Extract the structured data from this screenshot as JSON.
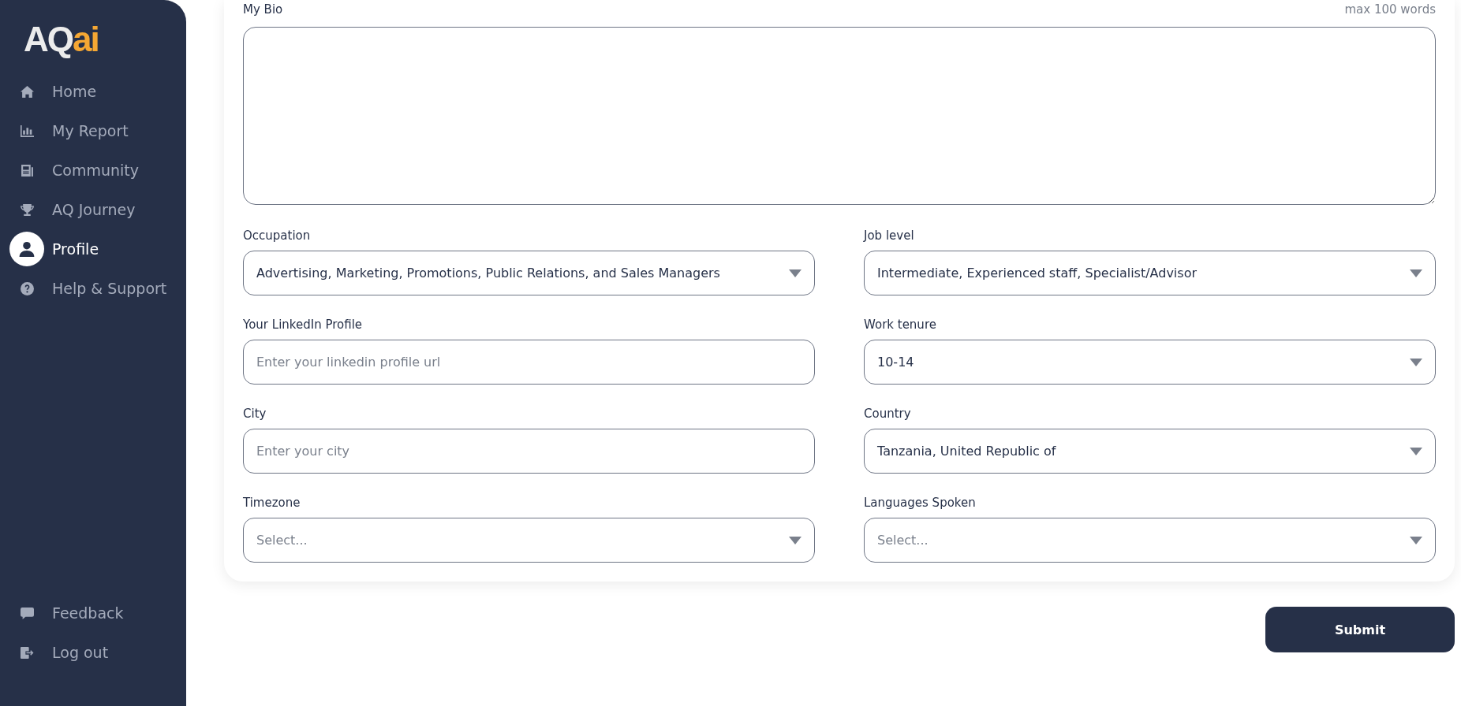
{
  "sidebar": {
    "logo": {
      "primary": "AQ",
      "accent": "ai"
    },
    "items": [
      {
        "label": "Home",
        "selected": false
      },
      {
        "label": "My Report",
        "selected": false
      },
      {
        "label": "Community",
        "selected": false
      },
      {
        "label": "AQ Journey",
        "selected": false
      },
      {
        "label": "Profile",
        "selected": true
      },
      {
        "label": "Help & Support",
        "selected": false
      }
    ],
    "bottom_items": [
      {
        "label": "Feedback",
        "selected": false
      },
      {
        "label": "Log out",
        "selected": false
      }
    ]
  },
  "form": {
    "bio": {
      "label": "My Bio",
      "hint": "max 100 words"
    },
    "fields": [
      {
        "kind": "select",
        "label": "Occupation",
        "value": "Advertising, Marketing, Promotions, Public Relations, and Sales Managers"
      },
      {
        "kind": "select",
        "label": "Job level",
        "value": "Intermediate, Experienced staff, Specialist/Advisor"
      },
      {
        "kind": "text",
        "label": "Your LinkedIn Profile",
        "placeholder": "Enter your linkedin profile url"
      },
      {
        "kind": "select",
        "label": "Work tenure",
        "value": "10-14"
      },
      {
        "kind": "text",
        "label": "City",
        "placeholder": "Enter your city"
      },
      {
        "kind": "select",
        "label": "Country",
        "value": "Tanzania, United Republic of"
      },
      {
        "kind": "select",
        "label": "Timezone",
        "placeholder": "Select..."
      },
      {
        "kind": "select",
        "label": "Languages Spoken",
        "placeholder": "Select..."
      }
    ]
  },
  "submit": "Submit"
}
